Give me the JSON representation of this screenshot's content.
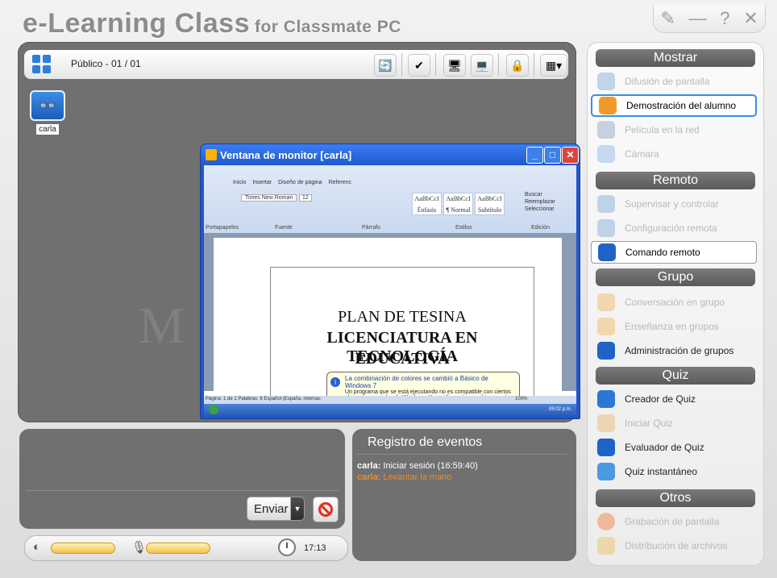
{
  "app": {
    "title": "e-Learning Class",
    "subtitle": "for Classmate PC",
    "controls": {
      "tool": "✎",
      "minimize": "—",
      "help": "?",
      "close": "✕"
    }
  },
  "toolbar": {
    "label": "Público - 01 / 01",
    "buttons": [
      "view-icon",
      "broadcast-icon",
      "monitor-icon",
      "screen-icon",
      "lock-icon",
      "layout-icon"
    ]
  },
  "student": {
    "name": "carla"
  },
  "monitor": {
    "title": "Ventana de monitor [carla]",
    "doc_line1": "PLAN DE TESINA",
    "doc_line2": "LICENCIATURA EN TECNOLOGÍA",
    "doc_line3": "EDUCATIVA",
    "ribbon_tabs": [
      "Inicio",
      "Insertar",
      "Diseño de página",
      "Referenc"
    ],
    "ribbon_font": "Times New Roman",
    "ribbon_size": "12",
    "ribbon_groups": [
      "Portapapeles",
      "Fuente",
      "Párrafo",
      "Estilos",
      "Edición"
    ],
    "ribbon_styles": [
      "AaBbCcI",
      "AaBbCcI",
      "AaBbCcI"
    ],
    "ribbon_style_names": [
      "Énfasis",
      "¶ Normal",
      "Subtítulo"
    ],
    "ribbon_edit": [
      "Buscar",
      "Reemplazar",
      "Seleccionar"
    ],
    "balloon_title": "La combinación de colores se cambió a Básico de Windows 7",
    "balloon_text": "Un programa que se está ejecutando no es compatible con ciertos elementos visuales de Windows. Haga clic aquí para obtener más información.",
    "status": "Página: 1 de 1   Palabras: 8   Español (España, internac",
    "zoom": "100%",
    "taskbar_time": "05:02 p.m."
  },
  "chat": {
    "send_label": "Enviar"
  },
  "status_bar": {
    "time": "17:13"
  },
  "events": {
    "title": "Registro de eventos",
    "entries": [
      {
        "user": "carla:",
        "text": "Iniciar sesión (16:59:40)",
        "color": "#ffffff"
      },
      {
        "user": "carla:",
        "text": "Levantar la mano",
        "color": "#f08a2a"
      }
    ]
  },
  "sidebar": {
    "sections": {
      "mostrar": "Mostrar",
      "remoto": "Remoto",
      "grupo": "Grupo",
      "quiz": "Quiz",
      "otros": "Otros"
    },
    "items": [
      {
        "label": "Difusión de pantalla",
        "state": "disabled",
        "icon": "broadcast-icon"
      },
      {
        "label": "Demostración del alumno",
        "state": "selected",
        "icon": "student-demo-icon"
      },
      {
        "label": "Película en la red",
        "state": "disabled",
        "icon": "film-icon"
      },
      {
        "label": "Cámara",
        "state": "disabled",
        "icon": "camera-icon"
      },
      {
        "label": "Supervisar y controlar",
        "state": "disabled",
        "icon": "monitor-control-icon"
      },
      {
        "label": "Configuración remota",
        "state": "disabled",
        "icon": "remote-config-icon"
      },
      {
        "label": "Comando remoto",
        "state": "highlighted",
        "icon": "remote-command-icon"
      },
      {
        "label": "Conversación en grupo",
        "state": "disabled",
        "icon": "chat-icon"
      },
      {
        "label": "Enseñanza en grupos",
        "state": "disabled",
        "icon": "group-teach-icon"
      },
      {
        "label": "Administración de grupos",
        "state": "enabled",
        "icon": "group-admin-icon"
      },
      {
        "label": "Creador de Quiz",
        "state": "enabled",
        "icon": "quiz-create-icon"
      },
      {
        "label": "Iniciar Quiz",
        "state": "disabled",
        "icon": "quiz-start-icon"
      },
      {
        "label": "Evaluador de Quiz",
        "state": "enabled",
        "icon": "quiz-grade-icon"
      },
      {
        "label": "Quiz instantáneo",
        "state": "enabled",
        "icon": "quiz-instant-icon"
      },
      {
        "label": "Grabación de pantalla",
        "state": "disabled",
        "icon": "record-icon"
      },
      {
        "label": "Distribución de archivos",
        "state": "disabled",
        "icon": "file-dist-icon"
      }
    ]
  },
  "colors": {
    "accent": "#3b8ee0",
    "panel": "#707070",
    "event_highlight": "#f08a2a"
  }
}
